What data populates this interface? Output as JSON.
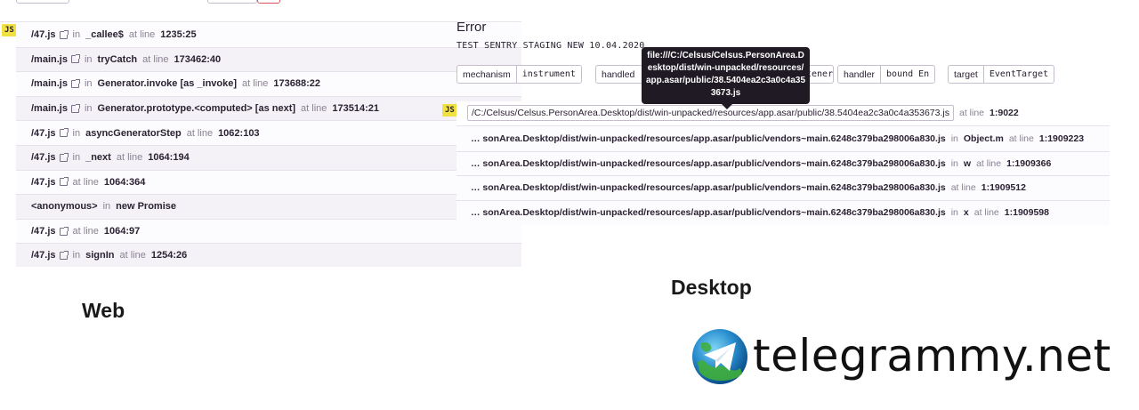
{
  "web": {
    "badge": "JS",
    "frames": [
      {
        "file": "/47.js",
        "in": "in",
        "func": "_callee$",
        "at": "at line",
        "line": "1235:25"
      },
      {
        "file": "/main.js",
        "in": "in",
        "func": "tryCatch",
        "at": "at line",
        "line": "173462:40"
      },
      {
        "file": "/main.js",
        "in": "in",
        "func": "Generator.invoke [as _invoke]",
        "at": "at line",
        "line": "173688:22"
      },
      {
        "file": "/main.js",
        "in": "in",
        "func": "Generator.prototype.<computed> [as next]",
        "at": "at line",
        "line": "173514:21"
      },
      {
        "file": "/47.js",
        "in": "in",
        "func": "asyncGeneratorStep",
        "at": "at line",
        "line": "1062:103"
      },
      {
        "file": "/47.js",
        "in": "in",
        "func": "_next",
        "at": "at line",
        "line": "1064:194"
      },
      {
        "file": "/47.js",
        "in": "",
        "func": "",
        "at": "at line",
        "line": "1064:364"
      },
      {
        "file": "<anonymous>",
        "in": "in",
        "func": "new Promise",
        "at": "",
        "line": ""
      },
      {
        "file": "/47.js",
        "in": "",
        "func": "",
        "at": "at line",
        "line": "1064:97"
      },
      {
        "file": "/47.js",
        "in": "in",
        "func": "signIn",
        "at": "at line",
        "line": "1254:26"
      }
    ],
    "label": "Web"
  },
  "desktop": {
    "title": "Error",
    "subtitle": "TEST SENTRY STAGING NEW 10.04.2020",
    "tags": [
      {
        "key": "mechanism",
        "value": "instrument"
      },
      {
        "key": "handled",
        "value": ""
      },
      {
        "key": "",
        "value": "tener"
      },
      {
        "key": "handler",
        "value": "bound En"
      },
      {
        "key": "target",
        "value": "EventTarget"
      }
    ],
    "tooltip": "file:///C:/Celsus/Celsus.PersonArea.Desktop/dist/win-unpacked/resources/app.asar/public/38.5404ea2c3a0c4a353673.js",
    "badge": "JS",
    "first_frame": {
      "path": "/C:/Celsus/Celsus.PersonArea.Desktop/dist/win-unpacked/resources/app.asar/public/38.5404ea2c3a0c4a353673.js",
      "at": "at line",
      "line": "1:9022"
    },
    "frames": [
      {
        "path": "… sonArea.Desktop/dist/win-unpacked/resources/app.asar/public/vendors~main.6248c379ba298006a830.js",
        "in": "in",
        "func": "Object.m",
        "at": "at line",
        "line": "1:1909223"
      },
      {
        "path": "… sonArea.Desktop/dist/win-unpacked/resources/app.asar/public/vendors~main.6248c379ba298006a830.js",
        "in": "in",
        "func": "w",
        "at": "at line",
        "line": "1:1909366"
      },
      {
        "path": "… sonArea.Desktop/dist/win-unpacked/resources/app.asar/public/vendors~main.6248c379ba298006a830.js",
        "in": "",
        "func": "",
        "at": "at line",
        "line": "1:1909512"
      },
      {
        "path": "… sonArea.Desktop/dist/win-unpacked/resources/app.asar/public/vendors~main.6248c379ba298006a830.js",
        "in": "in",
        "func": "x",
        "at": "at line",
        "line": "1:1909598"
      }
    ],
    "label": "Desktop"
  },
  "watermark": {
    "text": "telegrammy.net",
    "icon": "telegram-globe-icon"
  },
  "colors": {
    "badge": "#f0e040",
    "tooltip_bg": "#1f1a24",
    "border": "#c6becf",
    "top_stub_alert": "#e0575b"
  }
}
